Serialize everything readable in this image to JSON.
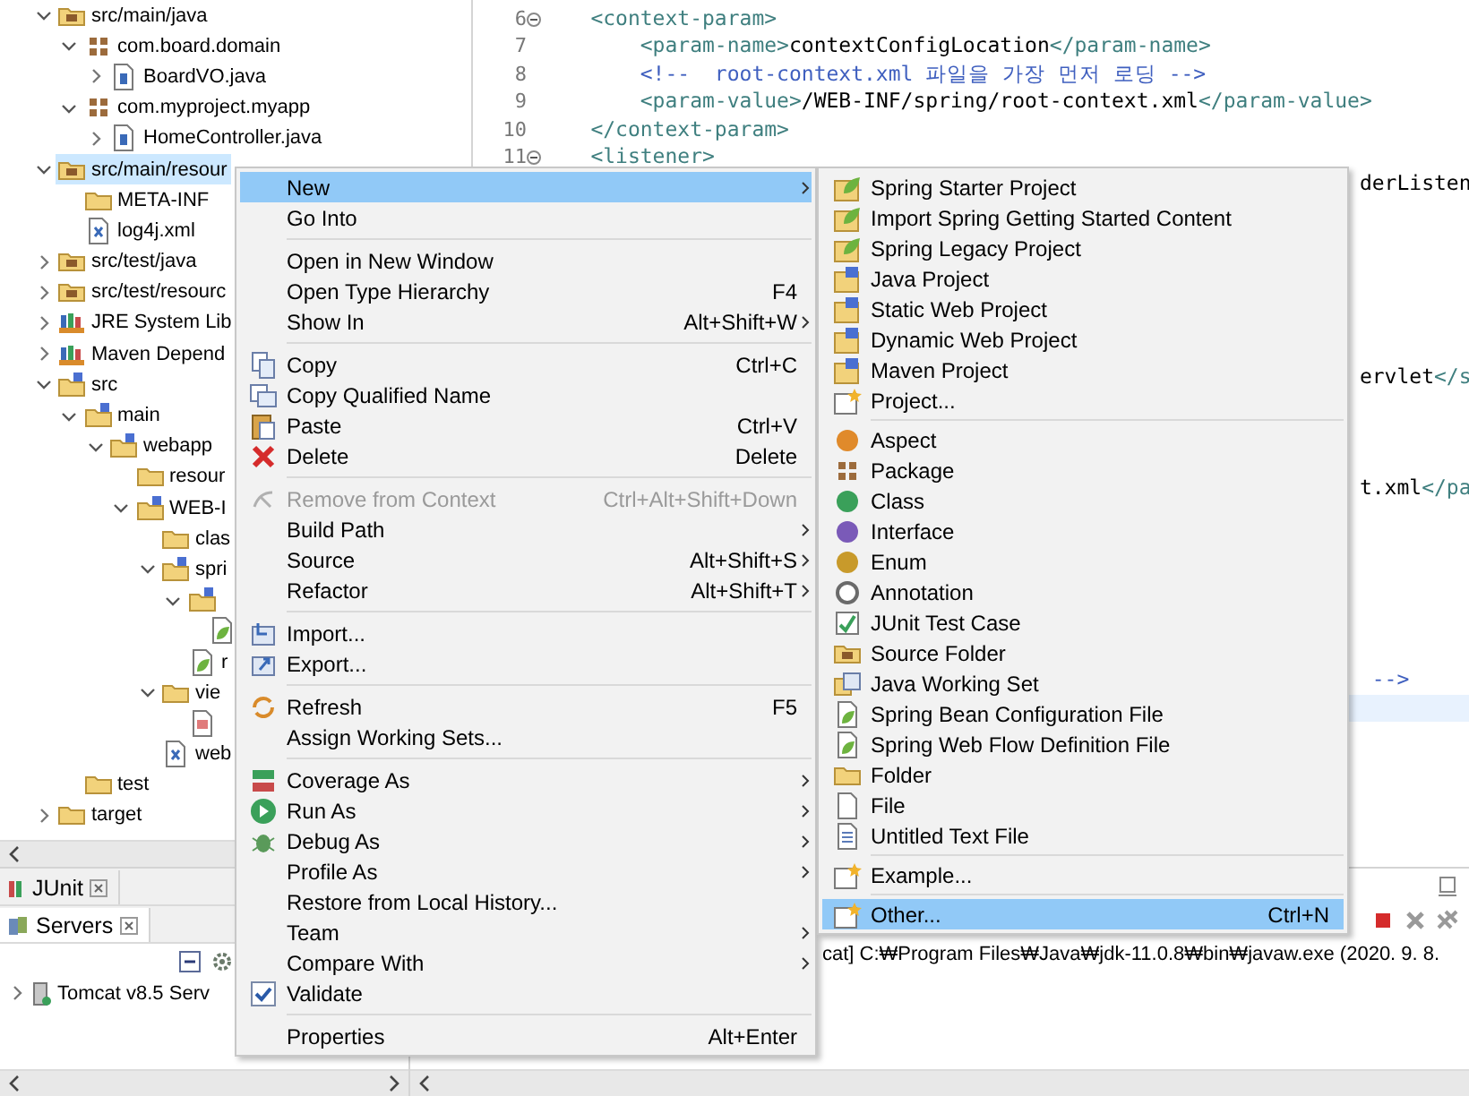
{
  "explorer": {
    "tree": [
      {
        "label": "src/main/java",
        "kind": "source-folder",
        "expanded": true,
        "selected": false,
        "children": [
          {
            "label": "com.board.domain",
            "kind": "package",
            "expanded": true,
            "selected": false,
            "children": [
              {
                "label": "BoardVO.java",
                "kind": "java-file",
                "expanded": false,
                "selected": false
              }
            ]
          },
          {
            "label": "com.myproject.myapp",
            "kind": "package",
            "expanded": true,
            "selected": false,
            "children": [
              {
                "label": "HomeController.java",
                "kind": "java-file",
                "expanded": false,
                "selected": false
              }
            ]
          }
        ]
      },
      {
        "label": "src/main/resour",
        "kind": "source-folder",
        "expanded": true,
        "selected": true,
        "children": [
          {
            "label": "META-INF",
            "kind": "folder",
            "selected": false
          },
          {
            "label": "log4j.xml",
            "kind": "xml-file",
            "selected": false
          }
        ]
      },
      {
        "label": "src/test/java",
        "kind": "source-folder",
        "expanded": false,
        "selected": false
      },
      {
        "label": "src/test/resourc",
        "kind": "source-folder",
        "expanded": false,
        "selected": false
      },
      {
        "label": "JRE System Lib",
        "kind": "library",
        "expanded": false,
        "selected": false
      },
      {
        "label": "Maven Depend",
        "kind": "library",
        "expanded": false,
        "selected": false
      },
      {
        "label": "src",
        "kind": "marked-folder",
        "expanded": true,
        "selected": false,
        "children": [
          {
            "label": "main",
            "kind": "marked-folder",
            "expanded": true,
            "selected": false,
            "children": [
              {
                "label": "webapp",
                "kind": "marked-folder",
                "expanded": true,
                "selected": false,
                "children": [
                  {
                    "label": "resour",
                    "kind": "folder",
                    "selected": false
                  },
                  {
                    "label": "WEB-I",
                    "kind": "marked-folder",
                    "expanded": true,
                    "selected": false,
                    "children": [
                      {
                        "label": "clas",
                        "kind": "folder",
                        "selected": false
                      },
                      {
                        "label": "spri",
                        "kind": "marked-folder",
                        "expanded": true,
                        "selected": false,
                        "children": [
                          {
                            "kind": "marked-folder",
                            "expanded": true,
                            "selected": false,
                            "children": [
                              {
                                "kind": "leaf-file",
                                "selected": false
                              }
                            ]
                          },
                          {
                            "label": "r",
                            "kind": "leaf-file",
                            "selected": false
                          }
                        ]
                      },
                      {
                        "label": "vie",
                        "kind": "folder",
                        "expanded": true,
                        "selected": false,
                        "children": [
                          {
                            "kind": "page-file",
                            "selected": false
                          }
                        ]
                      },
                      {
                        "label": "web",
                        "kind": "xml-file",
                        "selected": false
                      }
                    ]
                  }
                ]
              }
            ]
          },
          {
            "label": "test",
            "kind": "folder",
            "selected": false
          }
        ]
      },
      {
        "label": "target",
        "kind": "folder",
        "expanded": false,
        "selected": false
      }
    ]
  },
  "editor": {
    "lines": [
      {
        "number": "6",
        "foldable": true,
        "current": false,
        "segments": [
          {
            "kind": "tag",
            "text": "    <context-param>"
          }
        ]
      },
      {
        "number": "7",
        "foldable": false,
        "current": false,
        "segments": [
          {
            "kind": "tag",
            "text": "        <param-name>"
          },
          {
            "kind": "text",
            "text": "contextConfigLocation"
          },
          {
            "kind": "tag",
            "text": "</param-name>"
          }
        ]
      },
      {
        "number": "8",
        "foldable": false,
        "current": false,
        "segments": [
          {
            "kind": "comment",
            "text": "        <!--  root-context.xml 파일을 가장 먼저 로딩 -->"
          }
        ]
      },
      {
        "number": "9",
        "foldable": false,
        "current": false,
        "segments": [
          {
            "kind": "tag",
            "text": "        <param-value>"
          },
          {
            "kind": "text",
            "text": "/WEB-INF/spring/root-context.xml"
          },
          {
            "kind": "tag",
            "text": "</param-value>"
          }
        ]
      },
      {
        "number": "10",
        "foldable": false,
        "current": false,
        "segments": [
          {
            "kind": "tag",
            "text": "    </context-param>"
          }
        ]
      },
      {
        "number": "11",
        "foldable": true,
        "current": false,
        "segments": [
          {
            "kind": "tag",
            "text": "    <listener>"
          }
        ]
      },
      {
        "current": false,
        "segments": [
          {
            "kind": "text",
            "text": "derListen"
          }
        ]
      },
      {
        "current": false
      },
      {
        "current": false
      },
      {
        "current": false
      },
      {
        "current": false
      },
      {
        "current": false
      },
      {
        "current": false
      },
      {
        "current": false,
        "segments": [
          {
            "kind": "text",
            "text": "ervlet"
          },
          {
            "kind": "tag",
            "text": "</s"
          }
        ]
      },
      {
        "current": false
      },
      {
        "current": false
      },
      {
        "current": false
      },
      {
        "current": false,
        "segments": [
          {
            "kind": "text",
            "text": "t.xml"
          },
          {
            "kind": "tag",
            "text": "</pa"
          }
        ]
      },
      {
        "current": false
      },
      {
        "current": false
      },
      {
        "current": false
      },
      {
        "current": false
      },
      {
        "current": false
      },
      {
        "current": false
      },
      {
        "current": false,
        "segments": [
          {
            "kind": "comment",
            "text": " -->"
          }
        ]
      },
      {
        "current": true
      }
    ]
  },
  "servers_panel": {
    "tabs": [
      {
        "label": "JUnit",
        "selected": false
      },
      {
        "label": "Servers",
        "selected": true
      }
    ],
    "tree": [
      {
        "label": "Tomcat v8.5 Serv",
        "expanded": false
      }
    ]
  },
  "console": {
    "text": "cat] C:₩Program Files₩Java₩jdk-11.0.8₩bin₩javaw.exe  (2020. 9. 8."
  },
  "context_menu": {
    "items": [
      {
        "kind": "plain",
        "label": "New",
        "submenu": true,
        "selected": true,
        "disabled": false
      },
      {
        "kind": "plain",
        "label": "Go Into",
        "submenu": false,
        "selected": false,
        "disabled": false
      },
      {
        "kind": "separator"
      },
      {
        "kind": "plain",
        "label": "Open in New Window",
        "submenu": false,
        "selected": false,
        "disabled": false
      },
      {
        "kind": "plain",
        "label": "Open Type Hierarchy",
        "shortcut": "F4",
        "submenu": false,
        "selected": false,
        "disabled": false
      },
      {
        "kind": "plain",
        "label": "Show In",
        "shortcut": "Alt+Shift+W",
        "submenu": true,
        "selected": false,
        "disabled": false
      },
      {
        "kind": "separator"
      },
      {
        "kind": "copy",
        "label": "Copy",
        "shortcut": "Ctrl+C",
        "submenu": false,
        "selected": false,
        "disabled": false
      },
      {
        "kind": "copy-name",
        "label": "Copy Qualified Name",
        "submenu": false,
        "selected": false,
        "disabled": false
      },
      {
        "kind": "paste",
        "label": "Paste",
        "shortcut": "Ctrl+V",
        "submenu": false,
        "selected": false,
        "disabled": false
      },
      {
        "kind": "delete",
        "label": "Delete",
        "shortcut": "Delete",
        "submenu": false,
        "selected": false,
        "disabled": false
      },
      {
        "kind": "separator"
      },
      {
        "kind": "remove",
        "label": "Remove from Context",
        "shortcut": "Ctrl+Alt+Shift+Down",
        "submenu": false,
        "selected": false,
        "disabled": true
      },
      {
        "kind": "plain",
        "label": "Build Path",
        "submenu": true,
        "selected": false,
        "disabled": false
      },
      {
        "kind": "plain",
        "label": "Source",
        "shortcut": "Alt+Shift+S",
        "submenu": true,
        "selected": false,
        "disabled": false
      },
      {
        "kind": "plain",
        "label": "Refactor",
        "shortcut": "Alt+Shift+T",
        "submenu": true,
        "selected": false,
        "disabled": false
      },
      {
        "kind": "separator"
      },
      {
        "kind": "import",
        "label": "Import...",
        "submenu": false,
        "selected": false,
        "disabled": false
      },
      {
        "kind": "export",
        "label": "Export...",
        "submenu": false,
        "selected": false,
        "disabled": false
      },
      {
        "kind": "separator"
      },
      {
        "kind": "refresh",
        "label": "Refresh",
        "shortcut": "F5",
        "submenu": false,
        "selected": false,
        "disabled": false
      },
      {
        "kind": "plain",
        "label": "Assign Working Sets...",
        "submenu": false,
        "selected": false,
        "disabled": false
      },
      {
        "kind": "separator"
      },
      {
        "kind": "coverage",
        "label": "Coverage As",
        "submenu": true,
        "selected": false,
        "disabled": false
      },
      {
        "kind": "run",
        "label": "Run As",
        "submenu": true,
        "selected": false,
        "disabled": false
      },
      {
        "kind": "debug",
        "label": "Debug As",
        "submenu": true,
        "selected": false,
        "disabled": false
      },
      {
        "kind": "plain",
        "label": "Profile As",
        "submenu": true,
        "selected": false,
        "disabled": false
      },
      {
        "kind": "plain",
        "label": "Restore from Local History...",
        "submenu": false,
        "selected": false,
        "disabled": false
      },
      {
        "kind": "plain",
        "label": "Team",
        "submenu": true,
        "selected": false,
        "disabled": false
      },
      {
        "kind": "plain",
        "label": "Compare With",
        "submenu": true,
        "selected": false,
        "disabled": false
      },
      {
        "kind": "validate",
        "label": "Validate",
        "submenu": false,
        "selected": false,
        "disabled": false
      },
      {
        "kind": "separator"
      },
      {
        "kind": "plain",
        "label": "Properties",
        "shortcut": "Alt+Enter",
        "submenu": false,
        "selected": false,
        "disabled": false
      }
    ]
  },
  "new_submenu": {
    "items": [
      {
        "kind": "leaf-box",
        "label": "Spring Starter Project",
        "selected": false
      },
      {
        "kind": "leaf-box",
        "label": "Import Spring Getting Started Content",
        "selected": false
      },
      {
        "kind": "leaf-box",
        "label": "Spring Legacy Project",
        "selected": false
      },
      {
        "kind": "project",
        "label": "Java Project",
        "selected": false
      },
      {
        "kind": "project",
        "label": "Static Web Project",
        "selected": false
      },
      {
        "kind": "project",
        "label": "Dynamic Web Project",
        "selected": false
      },
      {
        "kind": "project",
        "label": "Maven Project",
        "selected": false
      },
      {
        "kind": "wizard",
        "label": "Project...",
        "selected": false
      },
      {
        "kind": "separator"
      },
      {
        "kind": "aspect",
        "label": "Aspect",
        "selected": false
      },
      {
        "kind": "package",
        "label": "Package",
        "selected": false
      },
      {
        "kind": "class",
        "label": "Class",
        "selected": false
      },
      {
        "kind": "interface",
        "label": "Interface",
        "selected": false
      },
      {
        "kind": "enum",
        "label": "Enum",
        "selected": false
      },
      {
        "kind": "annotation",
        "label": "Annotation",
        "selected": false
      },
      {
        "kind": "junit",
        "label": "JUnit Test Case",
        "selected": false
      },
      {
        "kind": "source-folder",
        "label": "Source Folder",
        "selected": false
      },
      {
        "kind": "working-set",
        "label": "Java Working Set",
        "selected": false
      },
      {
        "kind": "leaf-file",
        "label": "Spring Bean Configuration File",
        "selected": false
      },
      {
        "kind": "leaf-file",
        "label": "Spring Web Flow Definition File",
        "selected": false
      },
      {
        "kind": "folder",
        "label": "Folder",
        "selected": false
      },
      {
        "kind": "file",
        "label": "File",
        "selected": false
      },
      {
        "kind": "text-file",
        "label": "Untitled Text File",
        "selected": false
      },
      {
        "kind": "separator"
      },
      {
        "kind": "wizard",
        "label": "Example...",
        "selected": false
      },
      {
        "kind": "separator"
      },
      {
        "kind": "wizard",
        "label": "Other...",
        "shortcut": "Ctrl+N",
        "selected": true
      }
    ]
  }
}
